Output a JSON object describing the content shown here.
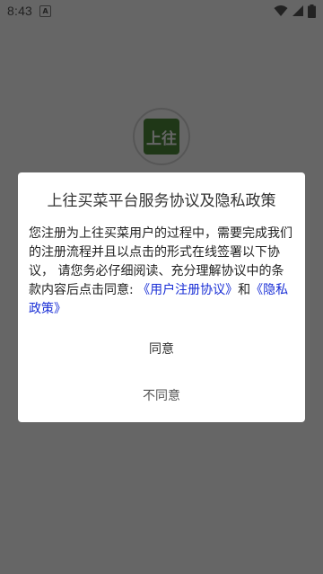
{
  "status_bar": {
    "time": "8:43",
    "notification_icon": "a-notification-icon",
    "icons": [
      "wifi-icon",
      "signal-icon",
      "battery-icon"
    ]
  },
  "background": {
    "logo_text": "上往"
  },
  "dialog": {
    "title": "上往买菜平台服务协议及隐私政策",
    "body_text": "您注册为上往买菜用户的过程中，需要完成我们的注册流程并且以点击的形式在线签署以下协议， 请您务必仔细阅读、充分理解协议中的条款内容后点击同意: ",
    "user_agreement_link": "《用户注册协议》",
    "and_text": "和",
    "privacy_link": "《隐私政策》",
    "agree_label": "同意",
    "disagree_label": "不同意"
  },
  "colors": {
    "link": "#1a2fd6",
    "scrim": "rgba(0,0,0,0.60)",
    "logo_bg": "#4e8b3a"
  }
}
